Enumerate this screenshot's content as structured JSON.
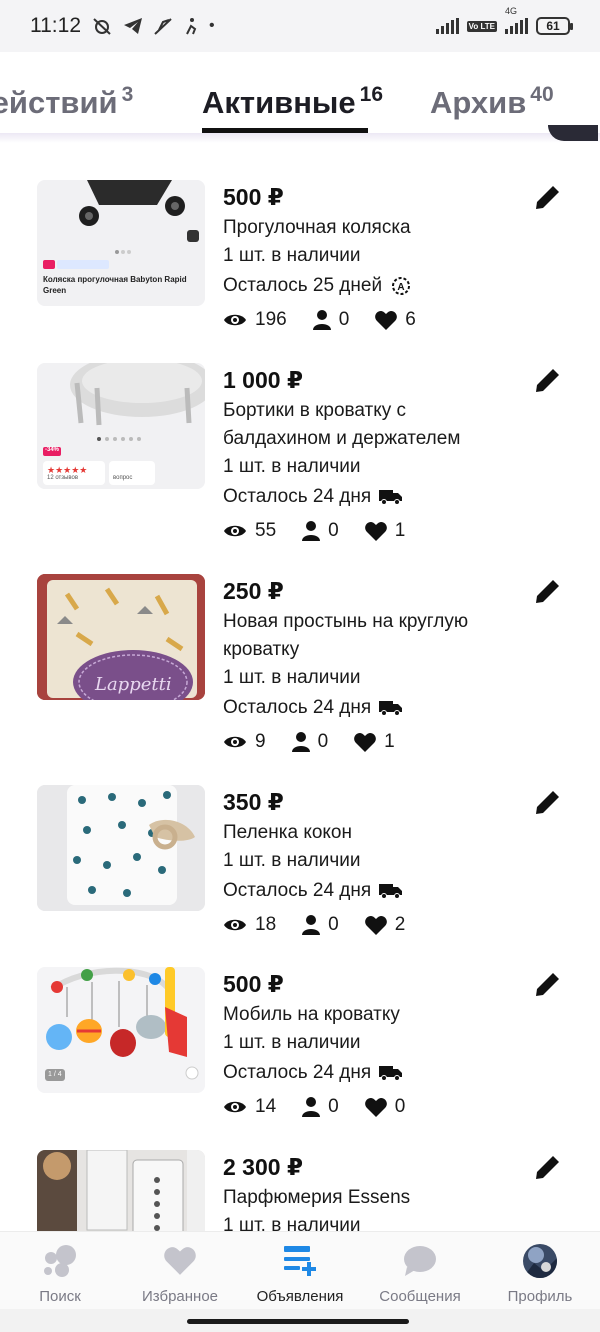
{
  "status_bar": {
    "time": "11:12",
    "volte": "Vo LTE",
    "network": "4G",
    "battery": "61"
  },
  "tabs": [
    {
      "label": "действий",
      "count": "3"
    },
    {
      "label": "Активные",
      "count": "16"
    },
    {
      "label": "Архив",
      "count": "40"
    }
  ],
  "listings": [
    {
      "price": "500 ₽",
      "title_lines": [
        "Прогулочная коляска"
      ],
      "stock": "1 шт. в наличии",
      "remaining": "Осталось 25 дней",
      "badge_icon": "auto-renew-icon",
      "views": "196",
      "contacts": "0",
      "favorites": "6",
      "thumb": {
        "caption": "Коляска прогулочная Babyton Rapid Green",
        "tag_price": "-21%",
        "tag_note": "Цена что надо"
      }
    },
    {
      "price": "1 000 ₽",
      "title_lines": [
        "Бортики в кроватку с",
        "балдахином и держателем"
      ],
      "stock": "1 шт. в наличии",
      "remaining": "Осталось 24 дня",
      "badge_icon": "delivery-truck-icon",
      "views": "55",
      "contacts": "0",
      "favorites": "1",
      "thumb": {
        "discount": "-34%",
        "reviews": "12 отзывов",
        "questions": "вопрос"
      }
    },
    {
      "price": "250 ₽",
      "title_lines": [
        "Новая простынь на круглую",
        "кроватку"
      ],
      "stock": "1 шт. в наличии",
      "remaining": "Осталось 24 дня",
      "badge_icon": "delivery-truck-icon",
      "views": "9",
      "contacts": "0",
      "favorites": "1",
      "thumb": {
        "brand": "Lappetti"
      }
    },
    {
      "price": "350 ₽",
      "title_lines": [
        "Пеленка кокон"
      ],
      "stock": "1 шт. в наличии",
      "remaining": "Осталось 24 дня",
      "badge_icon": "delivery-truck-icon",
      "views": "18",
      "contacts": "0",
      "favorites": "2",
      "thumb": {}
    },
    {
      "price": "500 ₽",
      "title_lines": [
        "Мобиль на кроватку"
      ],
      "stock": "1 шт. в наличии",
      "remaining": "Осталось 24 дня",
      "badge_icon": "delivery-truck-icon",
      "views": "14",
      "contacts": "0",
      "favorites": "0",
      "thumb": {
        "counter": "1 / 4"
      }
    },
    {
      "price": "2 300 ₽",
      "title_lines": [
        "Парфюмерия Essens"
      ],
      "stock": "1 шт. в наличии",
      "remaining": "",
      "badge_icon": "",
      "views": "",
      "contacts": "",
      "favorites": "",
      "thumb": {}
    }
  ],
  "bottom_nav": [
    {
      "label": "Поиск",
      "icon": "search-dots-icon"
    },
    {
      "label": "Избранное",
      "icon": "heart-icon"
    },
    {
      "label": "Объявления",
      "icon": "listings-add-icon",
      "active": true
    },
    {
      "label": "Сообщения",
      "icon": "chat-bubble-icon"
    },
    {
      "label": "Профиль",
      "icon": "avatar"
    }
  ],
  "colors": {
    "accent": "#1e88e5",
    "nav_inactive": "#c4c4cc",
    "text": "#111111"
  }
}
